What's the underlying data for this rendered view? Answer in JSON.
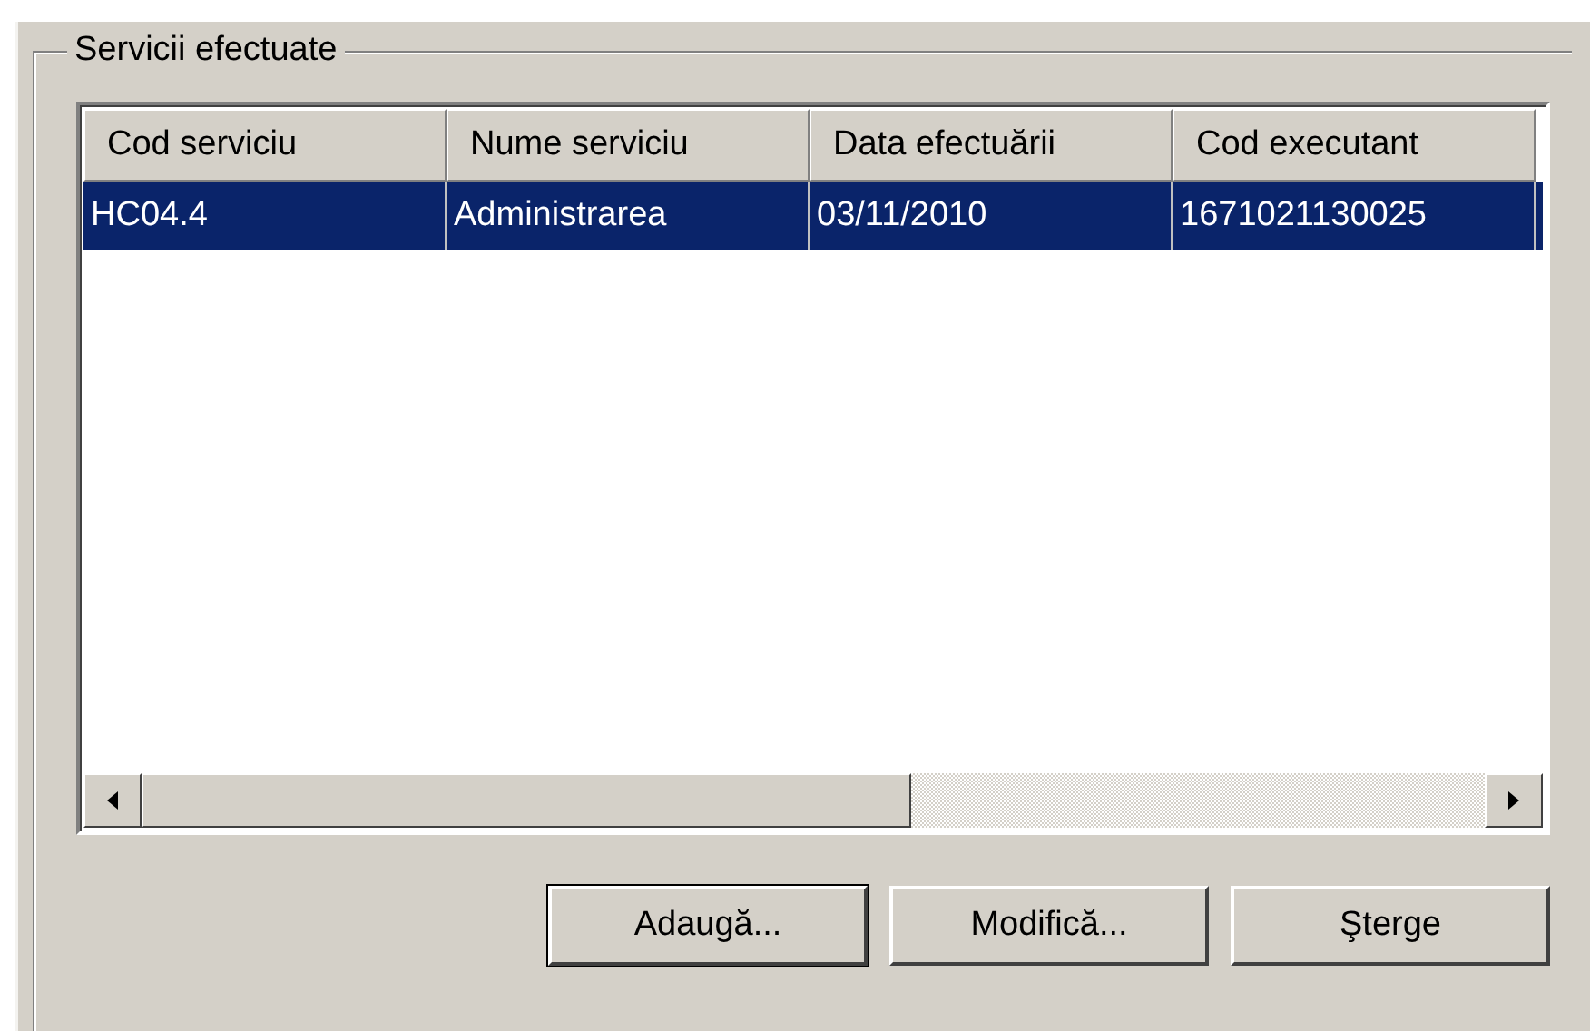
{
  "group": {
    "title": "Servicii efectuate"
  },
  "table": {
    "columns": [
      "Cod serviciu",
      "Nume serviciu",
      "Data efectuării",
      "Cod executant"
    ],
    "rows": [
      {
        "cells": [
          "HC04.4",
          "Administrarea",
          "03/11/2010",
          "1671021130025"
        ],
        "selected": true
      }
    ]
  },
  "buttons": [
    {
      "label": "Adaugă...",
      "default": true
    },
    {
      "label": "Modifică...",
      "default": false
    },
    {
      "label": "Şterge",
      "default": false
    }
  ]
}
